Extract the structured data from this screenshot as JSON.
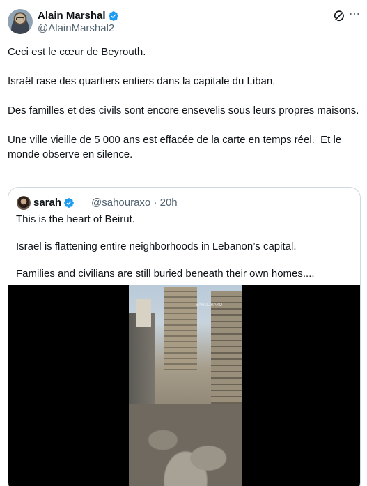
{
  "author": {
    "name": "Alain Marshal",
    "handle": "@AlainMarshal2"
  },
  "tweet": {
    "paragraphs": [
      "Ceci est le cœur de Beyrouth.",
      "Israël rase des quartiers entiers dans la capitale du Liban.",
      "Des familles et des civils sont encore ensevelis sous leurs propres maisons.",
      "Une ville vieille de 5 000 ans est effacée de la carte en temps réel.  Et le monde observe en silence."
    ]
  },
  "quote": {
    "name": "sarah",
    "handle": "@sahouraxo",
    "time": "20h",
    "separator": "·",
    "paragraphs": [
      "This is the heart of Beirut.",
      "Israel is flattening entire neighborhoods in Lebanon’s capital.",
      "Families and civilians are still buried beneath their own homes...."
    ],
    "media_watermark": "SAHOURAXO"
  },
  "icons": {
    "verified": "verified-badge-icon",
    "grok": "grok-icon",
    "more": "more-icon"
  },
  "colors": {
    "verified": "#1d9bf0",
    "secondary_text": "#536471",
    "border": "#cfd9de"
  }
}
